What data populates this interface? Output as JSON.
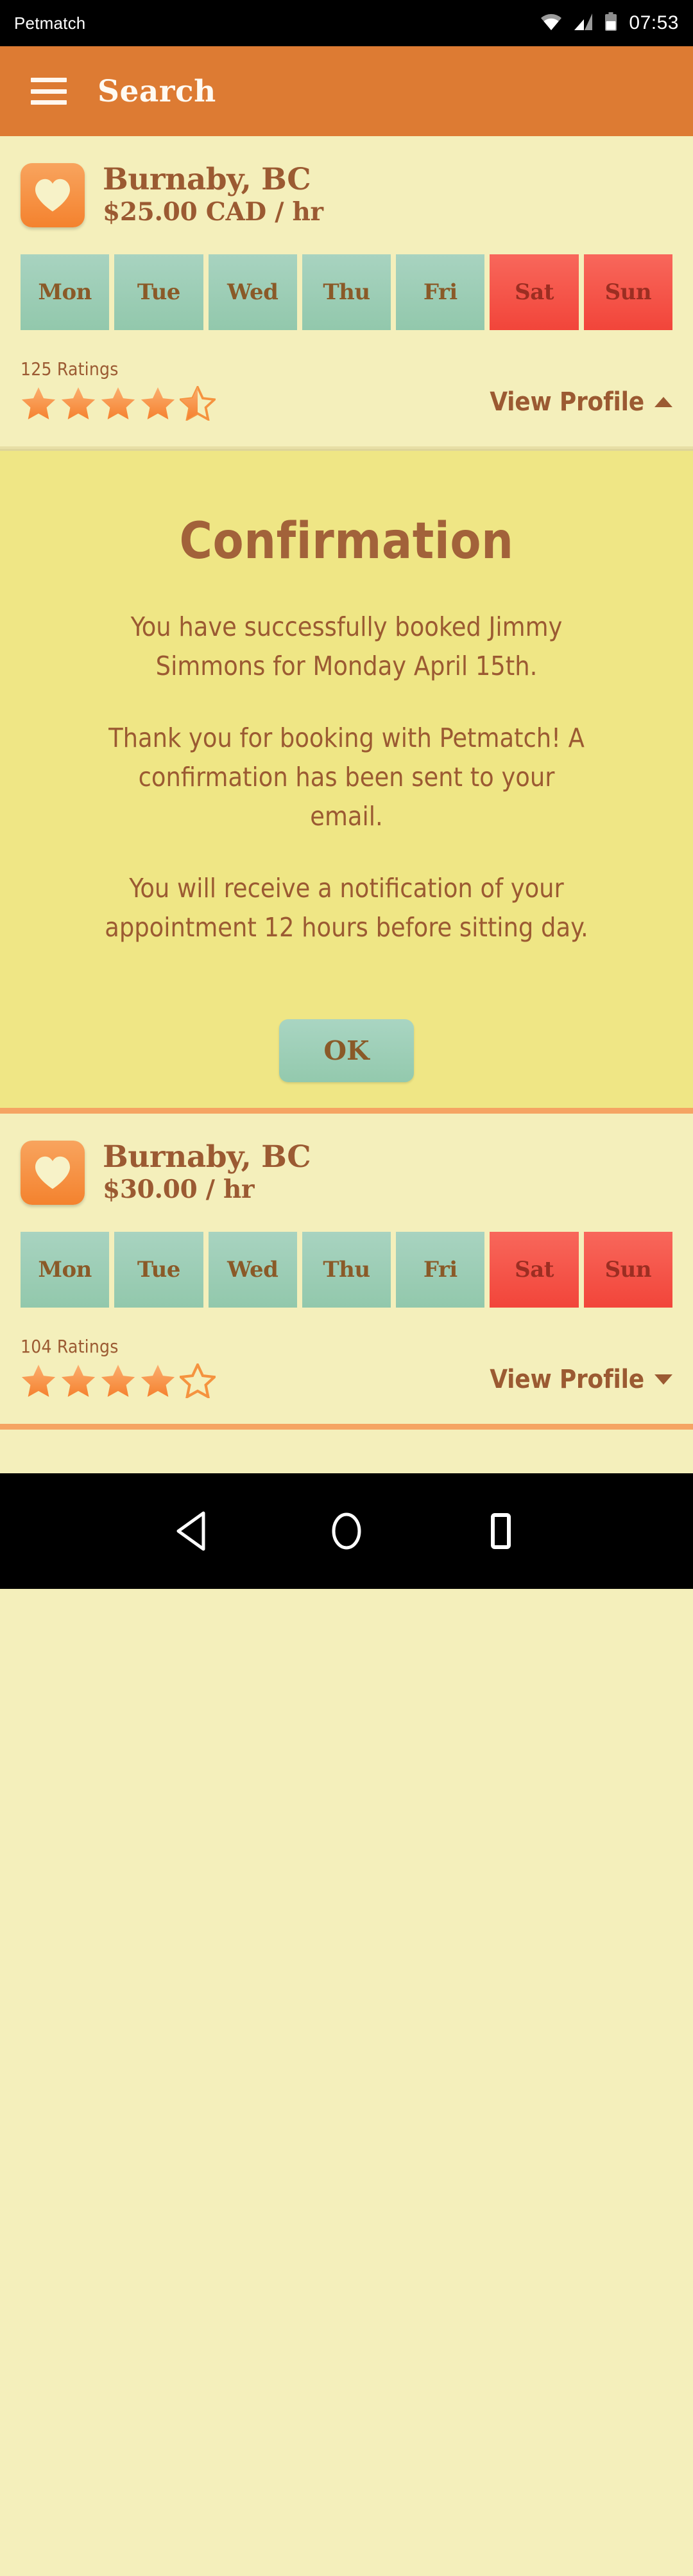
{
  "statusbar": {
    "app_name": "Petmatch",
    "clock": "07:53",
    "icons": [
      "wifi-icon",
      "cellular-signal-icon",
      "battery-icon"
    ]
  },
  "appbar": {
    "menu_icon": "hamburger-menu-icon",
    "title": "Search",
    "bg_color": "#dd7b33"
  },
  "colors": {
    "page_bg": "#f4efbb",
    "panel_bg": "#efe685",
    "brand_orange": "#dd7b33",
    "text_brown": "#9b5a32",
    "day_available": "#92c8ac",
    "day_busy": "#f2453a",
    "star_orange": "#f7944d"
  },
  "listings": [
    {
      "favorite_icon": "heart-icon",
      "city": "Burnaby, BC",
      "price": "$25.00 CAD / hr",
      "days": [
        {
          "label": "Mon",
          "state": "available"
        },
        {
          "label": "Tue",
          "state": "available"
        },
        {
          "label": "Wed",
          "state": "available"
        },
        {
          "label": "Thu",
          "state": "available"
        },
        {
          "label": "Fri",
          "state": "available"
        },
        {
          "label": "Sat",
          "state": "busy"
        },
        {
          "label": "Sun",
          "state": "busy"
        }
      ],
      "ratings_count": "125 Ratings",
      "stars": [
        1,
        1,
        1,
        1,
        0.5
      ],
      "view_profile_label": "View Profile",
      "view_profile_caret": "chevron-up-icon"
    },
    {
      "favorite_icon": "heart-icon",
      "city": "Burnaby, BC",
      "price": "$30.00 / hr",
      "days": [
        {
          "label": "Mon",
          "state": "available"
        },
        {
          "label": "Tue",
          "state": "available"
        },
        {
          "label": "Wed",
          "state": "available"
        },
        {
          "label": "Thu",
          "state": "available"
        },
        {
          "label": "Fri",
          "state": "available"
        },
        {
          "label": "Sat",
          "state": "busy"
        },
        {
          "label": "Sun",
          "state": "busy"
        }
      ],
      "ratings_count": "104 Ratings",
      "stars": [
        1,
        1,
        1,
        1,
        0
      ],
      "view_profile_label": "View Profile",
      "view_profile_caret": "chevron-down-icon"
    }
  ],
  "confirmation": {
    "title": "Confirmation",
    "paragraphs": [
      "You have successfully booked Jimmy Simmons for Monday April 15th.",
      "Thank you for booking with Petmatch! A confirmation has been sent to your email.",
      "You will receive a notification of your appointment 12 hours before sitting day."
    ],
    "ok_label": "OK"
  },
  "navbar": {
    "back": "back-triangle-icon",
    "home": "home-circle-icon",
    "recents": "recents-square-icon"
  }
}
